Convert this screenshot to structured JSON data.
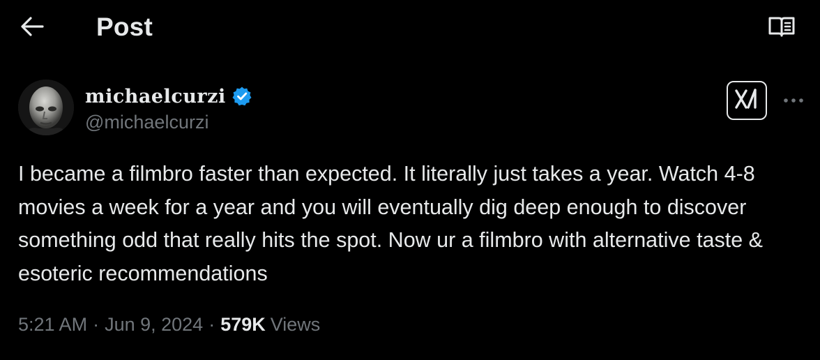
{
  "header": {
    "back_icon": "arrow-left-icon",
    "title": "Post",
    "reader_icon": "open-book-icon"
  },
  "author": {
    "avatar_icon": "avatar",
    "display_name": "michaelcurzi",
    "verified_icon": "verified-badge-icon",
    "handle": "@michaelcurzi"
  },
  "actions": {
    "grok_icon": "grok-icon",
    "more_icon": "more-horizontal-icon"
  },
  "tweet": {
    "text": "I became a filmbro faster than expected. It literally just takes a year. Watch 4-8 movies a week for a year and you will eventually dig deep enough to discover something odd that really hits the spot. Now ur a filmbro with alternative taste & esoteric recommendations"
  },
  "meta": {
    "time": "5:21 AM",
    "separator": "·",
    "date": "Jun 9, 2024",
    "views_count": "579K",
    "views_label": "Views"
  },
  "colors": {
    "background": "#000000",
    "text_primary": "#e7e9ea",
    "text_secondary": "#71767b",
    "verified_blue": "#1d9bf0"
  }
}
